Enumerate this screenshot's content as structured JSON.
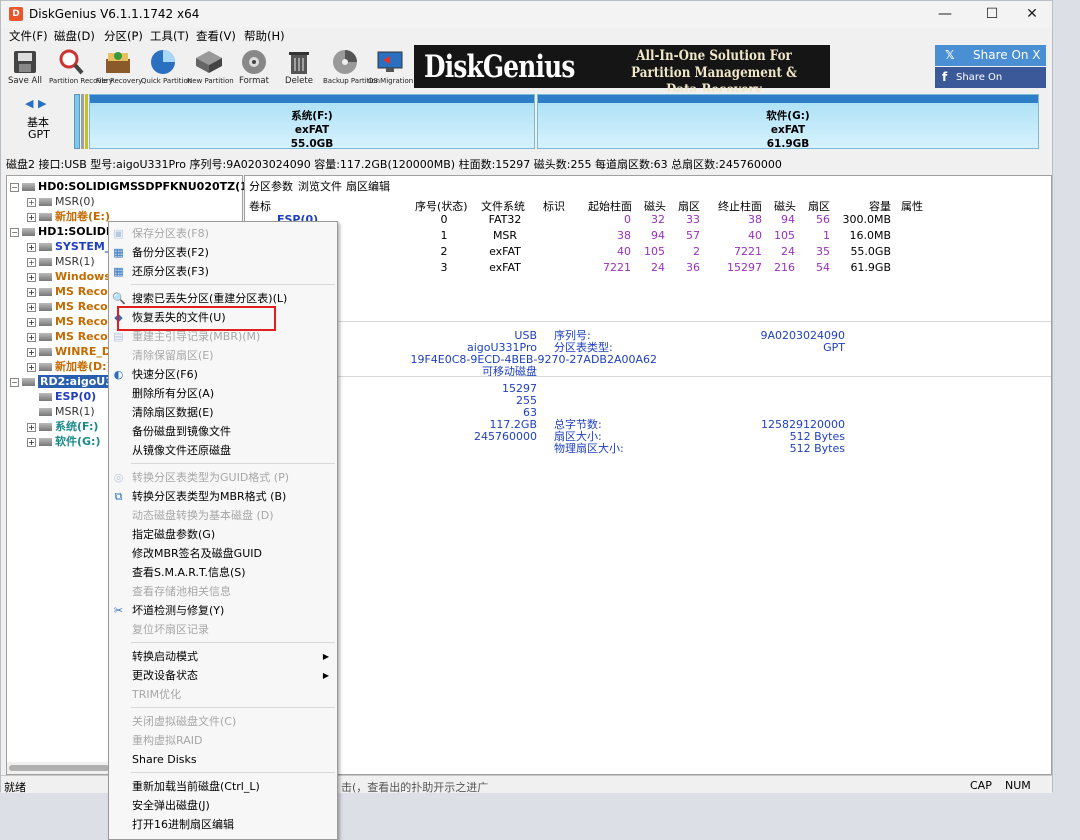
{
  "window": {
    "title": "DiskGenius V6.1.1.1742 x64",
    "min": "—",
    "max": "☐",
    "close": "✕"
  },
  "menu": [
    "文件(F)",
    "磁盘(D)",
    "分区(P)",
    "工具(T)",
    "查看(V)",
    "帮助(H)"
  ],
  "toolbar": [
    {
      "label": "Save All",
      "icon": "save-icon"
    },
    {
      "label": "Partition Recovery",
      "icon": "magnifier-icon"
    },
    {
      "label": "File Recovery",
      "icon": "file-recovery-icon"
    },
    {
      "label": "Quick Partition",
      "icon": "quick-partition-icon"
    },
    {
      "label": "New Partition",
      "icon": "new-partition-icon"
    },
    {
      "label": "Format",
      "icon": "format-icon"
    },
    {
      "label": "Delete",
      "icon": "trash-icon"
    },
    {
      "label": "Backup Partition",
      "icon": "backup-icon"
    },
    {
      "label": "OS Migration",
      "icon": "migration-icon"
    }
  ],
  "banner": {
    "logo": "DiskGenius",
    "line1": "All-In-One Solution For",
    "line2": "Partition Management & Data Recovery"
  },
  "share": {
    "x": "Share On X",
    "facebook": "Share On Facebook"
  },
  "disk_nav": {
    "line1": "基本",
    "line2": "GPT"
  },
  "partitions": [
    {
      "name": "系统(F:)",
      "fs": "exFAT",
      "size": "55.0GB"
    },
    {
      "name": "软件(G:)",
      "fs": "exFAT",
      "size": "61.9GB"
    }
  ],
  "disk_info": "磁盘2 接口:USB 型号:aigoU331Pro 序列号:9A0203024090 容量:117.2GB(120000MB) 柱面数:15297 磁头数:255 每道扇区数:63 总扇区数:245760000",
  "tree": [
    {
      "label": "HD0:SOLIDIGMSSDPFKNU020TZ(1908",
      "cls": "gray"
    },
    {
      "label": "MSR(0)",
      "cls": "gray"
    },
    {
      "label": "新加卷(E:)",
      "cls": "orange"
    },
    {
      "label": "HD1:SOLIDIG",
      "cls": "gray"
    },
    {
      "label": "SYSTEM_D",
      "cls": "blue"
    },
    {
      "label": "MSR(1)",
      "cls": "gray"
    },
    {
      "label": "Windows-",
      "cls": "orange"
    },
    {
      "label": "MS Recove",
      "cls": "orange"
    },
    {
      "label": "MS Recove",
      "cls": "orange"
    },
    {
      "label": "MS Recove",
      "cls": "orange"
    },
    {
      "label": "MS Recove",
      "cls": "orange"
    },
    {
      "label": "WINRE_DF",
      "cls": "orange"
    },
    {
      "label": "新加卷(D:)",
      "cls": "orange"
    },
    {
      "label": "RD2:aigoU33",
      "cls": "sel"
    },
    {
      "label": "ESP(0)",
      "cls": "blue"
    },
    {
      "label": "MSR(1)",
      "cls": "gray"
    },
    {
      "label": "系统(F:)",
      "cls": "teal"
    },
    {
      "label": "软件(G:)",
      "cls": "teal"
    }
  ],
  "tabs": [
    "分区参数",
    "浏览文件",
    "扇区编辑"
  ],
  "columns": [
    "卷标",
    "序号(状态)",
    "文件系统",
    "标识",
    "起始柱面",
    "磁头",
    "扇区",
    "终止柱面",
    "磁头",
    "扇区",
    "容量",
    "属性"
  ],
  "rows": [
    [
      "ESP(0)",
      "0",
      "FAT32",
      "",
      "0",
      "32",
      "33",
      "38",
      "94",
      "56",
      "300.0MB"
    ],
    [
      "",
      "1",
      "MSR",
      "",
      "38",
      "94",
      "57",
      "40",
      "105",
      "1",
      "16.0MB"
    ],
    [
      "",
      "2",
      "exFAT",
      "",
      "40",
      "105",
      "2",
      "7221",
      "24",
      "35",
      "55.0GB"
    ],
    [
      "",
      "3",
      "exFAT",
      "",
      "7221",
      "24",
      "36",
      "15297",
      "216",
      "54",
      "61.9GB"
    ]
  ],
  "details": {
    "iface": "USB",
    "model": "aigoU331Pro",
    "guid": "19F4E0C8-9ECD-4BEB-9270-27ADB2A00A62",
    "type": "可移动磁盘",
    "serial_label": "序列号:",
    "serial": "9A0203024090",
    "pt_label": "分区表类型:",
    "pt": "GPT",
    "cyl": "15297",
    "heads": "255",
    "spt": "63",
    "cap": "117.2GB",
    "sectors": "245760000",
    "bytes_label": "总字节数:",
    "bytes": "125829120000",
    "ss_label": "扇区大小:",
    "ss": "512 Bytes",
    "pss_label": "物理扇区大小:",
    "pss": "512 Bytes"
  },
  "status": {
    "left": "就绪",
    "cap": "CAP",
    "num": "NUM",
    "hint": "击(，查看出的扑助开示之进广"
  },
  "context_menu": [
    {
      "label": "保存分区表(F8)",
      "dis": true,
      "icon": "save-icon"
    },
    {
      "label": "备份分区表(F2)",
      "dis": false,
      "icon": "backup-table-icon"
    },
    {
      "label": "还原分区表(F3)",
      "dis": false,
      "icon": "restore-table-icon"
    },
    {
      "sep": true
    },
    {
      "label": "搜索已丢失分区(重建分区表)(L)",
      "dis": false,
      "icon": "search-icon"
    },
    {
      "label": "恢复丢失的文件(U)",
      "dis": false,
      "icon": "recover-files-icon"
    },
    {
      "label": "重建主引导记录(MBR)(M)",
      "dis": true,
      "icon": "mbr-icon"
    },
    {
      "label": "清除保留扇区(E)",
      "dis": true
    },
    {
      "label": "快速分区(F6)",
      "dis": false,
      "icon": "quick-partition-icon"
    },
    {
      "label": "删除所有分区(A)",
      "dis": false
    },
    {
      "label": "清除扇区数据(E)",
      "dis": false
    },
    {
      "label": "备份磁盘到镜像文件",
      "dis": false
    },
    {
      "label": "从镜像文件还原磁盘",
      "dis": false
    },
    {
      "sep": true
    },
    {
      "label": "转换分区表类型为GUID格式 (P)",
      "dis": true,
      "icon": "convert-icon"
    },
    {
      "label": "转换分区表类型为MBR格式 (B)",
      "dis": false,
      "icon": "convert-mbr-icon"
    },
    {
      "label": "动态磁盘转换为基本磁盘 (D)",
      "dis": true
    },
    {
      "label": "指定磁盘参数(G)",
      "dis": false
    },
    {
      "label": "修改MBR签名及磁盘GUID",
      "dis": false
    },
    {
      "label": "查看S.M.A.R.T.信息(S)",
      "dis": false
    },
    {
      "label": "查看存储池相关信息",
      "dis": true
    },
    {
      "label": "坏道检测与修复(Y)",
      "dis": false,
      "icon": "tools-icon"
    },
    {
      "label": "复位坏扇区记录",
      "dis": true
    },
    {
      "sep": true
    },
    {
      "label": "转换启动模式",
      "dis": false,
      "sub": true
    },
    {
      "label": "更改设备状态",
      "dis": false,
      "sub": true
    },
    {
      "label": "TRIM优化",
      "dis": true
    },
    {
      "sep": true
    },
    {
      "label": "关闭虚拟磁盘文件(C)",
      "dis": true
    },
    {
      "label": "重构虚拟RAID",
      "dis": true
    },
    {
      "label": "Share Disks",
      "dis": false
    },
    {
      "sep": true
    },
    {
      "label": "重新加载当前磁盘(Ctrl_L)",
      "dis": false
    },
    {
      "label": "安全弹出磁盘(J)",
      "dis": false
    },
    {
      "label": "打开16进制扇区编辑",
      "dis": false
    }
  ]
}
